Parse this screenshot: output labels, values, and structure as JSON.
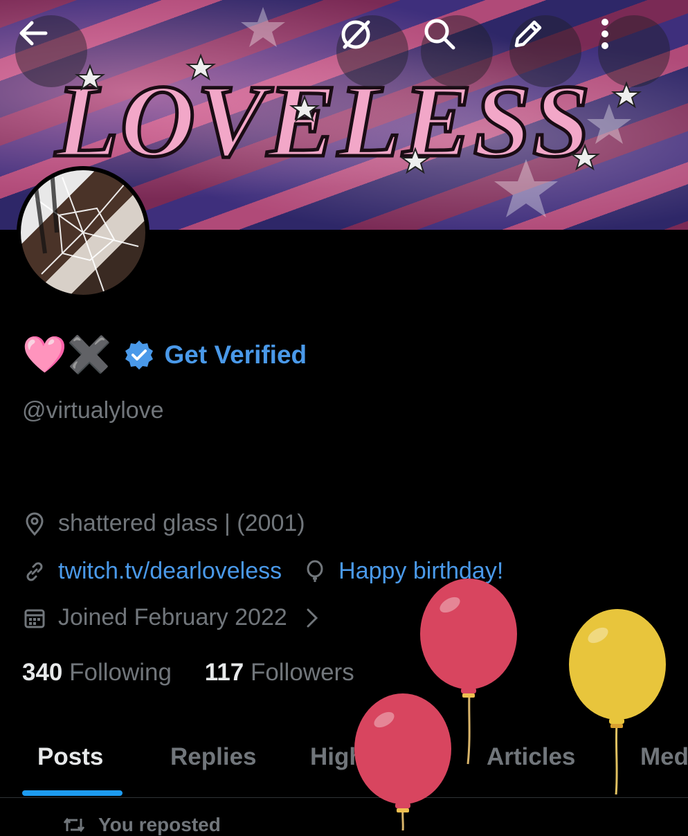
{
  "banner": {
    "art_text": "LOVELESS"
  },
  "header": {
    "back_icon": "arrow-left-icon",
    "grok_icon": "grok-icon",
    "search_icon": "search-icon",
    "edit_icon": "pencil-icon",
    "more_icon": "more-vertical-icon"
  },
  "profile": {
    "display_name_emoji": "🩷✖️",
    "get_verified_label": "Get Verified",
    "handle": "@virtualylove",
    "location": "shattered glass | (2001)",
    "website": "twitch.tv/dearloveless",
    "birthday": "Happy birthday!",
    "joined": "Joined February 2022",
    "following_count": "340",
    "following_label": "Following",
    "followers_count": "117",
    "followers_label": "Followers"
  },
  "tabs": [
    {
      "label": "Posts"
    },
    {
      "label": "Replies"
    },
    {
      "label": "Highlights"
    },
    {
      "label": "Articles"
    },
    {
      "label": "Media"
    }
  ],
  "feed": {
    "repost_label": "You reposted"
  },
  "colors": {
    "accent": "#1d9bf0",
    "link": "#4a99e9",
    "muted": "#71767b",
    "balloon_red": "#d8455f",
    "balloon_yellow": "#e8c53c"
  }
}
